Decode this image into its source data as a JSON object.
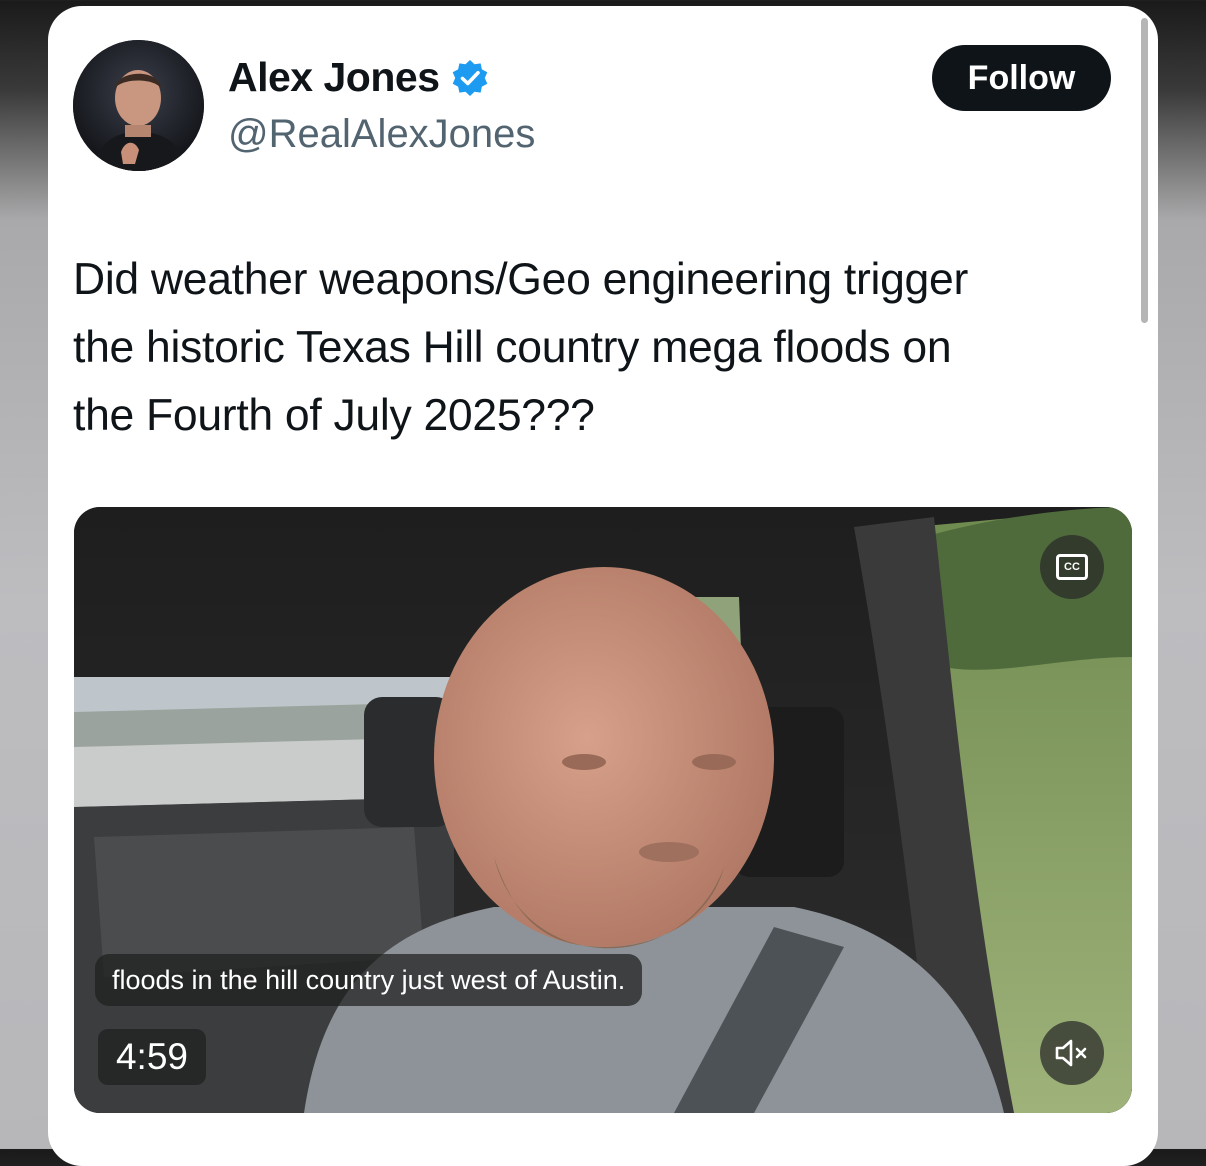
{
  "author": {
    "name": "Alex Jones",
    "handle": "@RealAlexJones",
    "verified": true
  },
  "actions": {
    "follow_label": "Follow"
  },
  "tweet": {
    "lines": [
      "Did weather weapons/Geo engineering trigger",
      "the historic Texas Hill country mega floods on",
      "the Fourth of July 2025???"
    ]
  },
  "video": {
    "caption": "floods in the hill country just west of Austin.",
    "duration": "4:59",
    "cc_label": "CC",
    "muted": true
  },
  "icons": {
    "verified": "verified-badge-icon",
    "captions": "closed-captions-icon",
    "mute": "speaker-muted-icon"
  },
  "colors": {
    "verified_blue": "#1d9bf0",
    "text_primary": "#0f1419",
    "text_secondary": "#536471",
    "follow_bg": "#0f1419"
  }
}
